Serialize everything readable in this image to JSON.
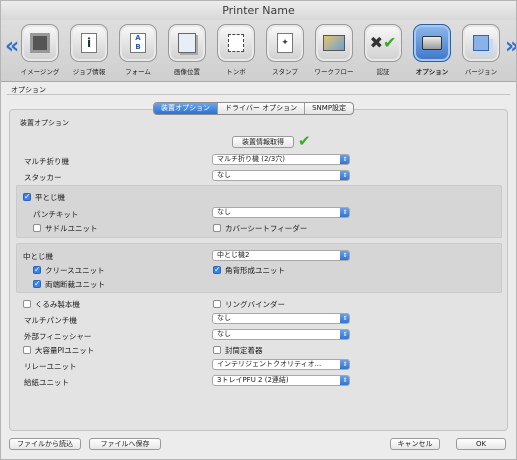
{
  "window": {
    "title": "Printer Name"
  },
  "toolbar": {
    "items": [
      {
        "label": "イメージング",
        "icon": "imaging-icon"
      },
      {
        "label": "ジョブ情報",
        "icon": "job-info-icon"
      },
      {
        "label": "フォーム",
        "icon": "form-icon"
      },
      {
        "label": "画像位置",
        "icon": "image-position-icon"
      },
      {
        "label": "トンボ",
        "icon": "crop-marks-icon"
      },
      {
        "label": "スタンプ",
        "icon": "stamp-icon"
      },
      {
        "label": "ワークフロー",
        "icon": "workflow-icon"
      },
      {
        "label": "認証",
        "icon": "authentication-icon"
      },
      {
        "label": "オプション",
        "icon": "options-icon"
      },
      {
        "label": "バージョン",
        "icon": "version-icon"
      }
    ]
  },
  "section_title": "オプション",
  "tabs": [
    "装置オプション",
    "ドライバー オプション",
    "SNMP設定"
  ],
  "panel_title": "装置オプション",
  "get_info_button": "装置情報取得",
  "rows": {
    "multi_fold": {
      "label": "マルチ折り機",
      "value": "マルチ折り機 (2/3穴)"
    },
    "stacker": {
      "label": "スタッカー",
      "value": "なし"
    },
    "flat_stitch": {
      "label": "平とじ機",
      "checked": true
    },
    "punch_kit": {
      "label": "パンチキット",
      "value": "なし"
    },
    "saddle_unit": {
      "label": "サドルユニット",
      "checked": false
    },
    "cover_sheet": {
      "label": "カバーシートフィーダー",
      "checked": false
    },
    "saddle_stitch": {
      "label": "中とじ機",
      "value": "中とじ機2"
    },
    "crease_unit": {
      "label": "クリースユニット",
      "checked": true
    },
    "square_fold": {
      "label": "角背形成ユニット",
      "checked": true
    },
    "both_trim": {
      "label": "両端断裁ユニット",
      "checked": true
    },
    "perfect_binder": {
      "label": "くるみ製本機",
      "checked": false
    },
    "ring_binder": {
      "label": "リングバインダー",
      "checked": false
    },
    "multi_punch": {
      "label": "マルチパンチ機",
      "value": "なし"
    },
    "external_finisher": {
      "label": "外部フィニッシャー",
      "value": "なし"
    },
    "large_capacity": {
      "label": "大容量PIユニット",
      "checked": false
    },
    "envelope_fuser": {
      "label": "封筒定着器",
      "checked": false
    },
    "relay_unit": {
      "label": "リレーユニット",
      "value": "インテリジェントクオリティオ..."
    },
    "paper_feed": {
      "label": "給紙ユニット",
      "value": "3トレイPFU 2 (2連結)"
    }
  },
  "footer": {
    "load": "ファイルから読込",
    "save": "ファイルへ保存",
    "cancel": "キャンセル",
    "ok": "OK"
  },
  "colors": {
    "accent": "#2e6fd3",
    "check_green": "#3aaa2a"
  }
}
